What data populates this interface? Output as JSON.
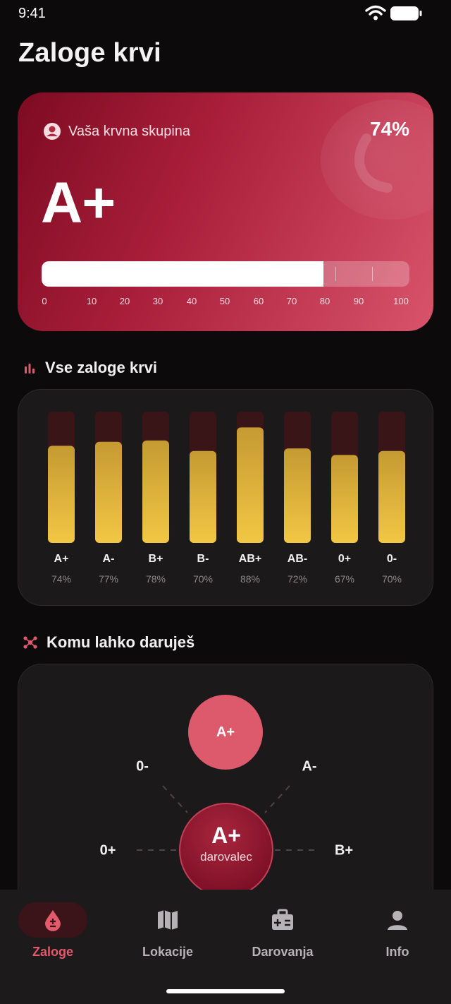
{
  "status_bar": {
    "time": "9:41"
  },
  "page_title": "Zaloge krvi",
  "hero": {
    "label": "Vaša krvna skupina",
    "blood_type": "A+",
    "percent_text": "74%",
    "level": 74,
    "scale_labels": [
      "0",
      "10",
      "20",
      "30",
      "40",
      "50",
      "60",
      "70",
      "80",
      "90",
      "100"
    ]
  },
  "sections": {
    "all_supplies": "Vse zaloge krvi",
    "donate_to": "Komu lahko daruješ"
  },
  "chart_data": {
    "type": "bar",
    "categories": [
      "A+",
      "A-",
      "B+",
      "B-",
      "AB+",
      "AB-",
      "0+",
      "0-"
    ],
    "values": [
      74,
      77,
      78,
      70,
      88,
      72,
      67,
      70
    ],
    "value_labels": [
      "74%",
      "77%",
      "78%",
      "70%",
      "88%",
      "72%",
      "67%",
      "70%"
    ],
    "ylim": [
      0,
      100
    ],
    "grid": false
  },
  "donor_graph": {
    "donor": {
      "type": "A+",
      "label": "darovalec"
    },
    "recipient": "A+",
    "compatible": [
      "0-",
      "A-",
      "0+",
      "B+"
    ]
  },
  "bottom_nav": [
    {
      "label": "Zaloge",
      "icon": "blood-drop-icon",
      "active": true
    },
    {
      "label": "Lokacije",
      "icon": "map-icon",
      "active": false
    },
    {
      "label": "Darovanja",
      "icon": "medical-kit-icon",
      "active": false
    },
    {
      "label": "Info",
      "icon": "person-icon",
      "active": false
    }
  ],
  "colors": {
    "accent": "#dc5a6c",
    "hero_start": "#7d0b22",
    "hero_end": "#d9546a",
    "bar_top": "#c59a32",
    "bar_bottom": "#f2c744",
    "bar_track": "#3a1518",
    "background": "#0c0a0b"
  }
}
